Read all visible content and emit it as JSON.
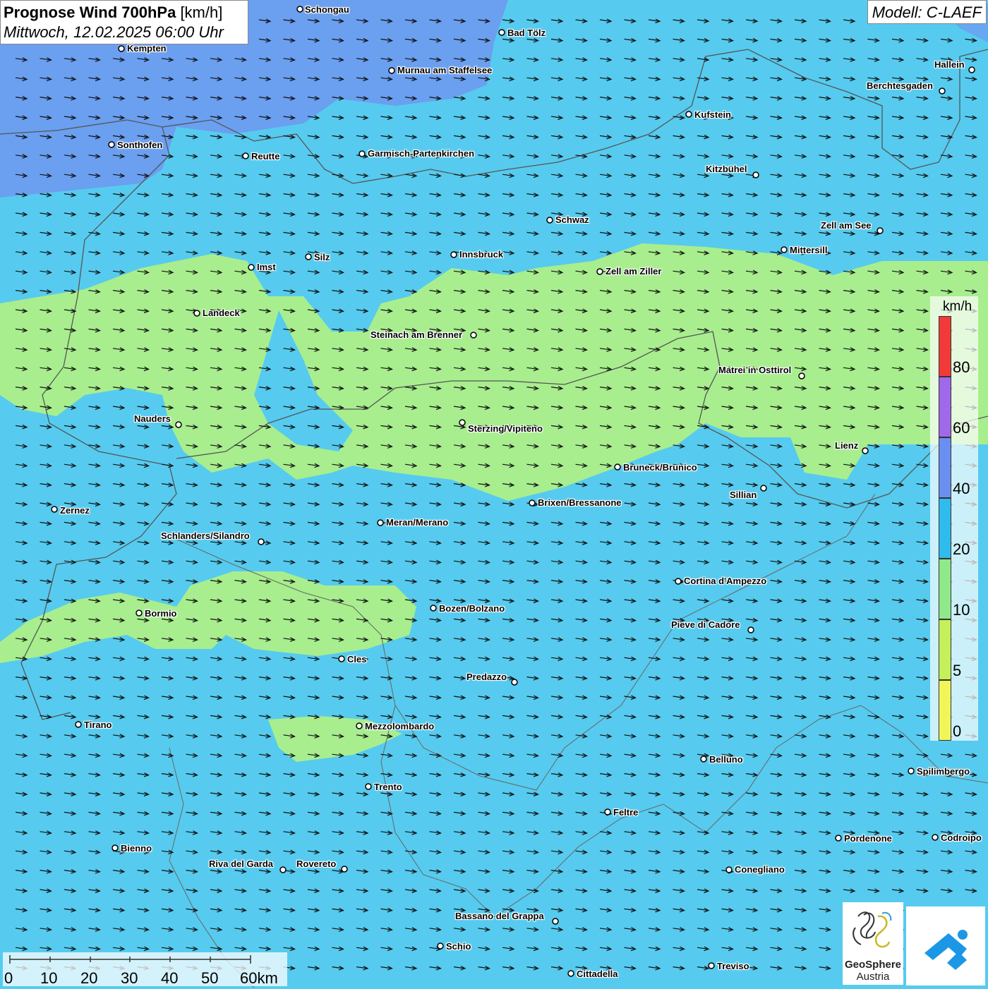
{
  "header": {
    "title_bold": "Prognose Wind 700hPa",
    "title_unit": "[km/h]",
    "date": "Mittwoch, 12.02.2025 06:00 Uhr",
    "model": "Modell: C-LAEF"
  },
  "colors": {
    "bg_wind_10_20": "#56cbef",
    "wind_5_10": "#a8ee8e",
    "wind_20_40": "#6b9ff0",
    "wind_40_60": "#7b6fd8",
    "border_line": "#555555",
    "arrow": "#111111"
  },
  "legend": {
    "unit": "km/h",
    "ticks": [
      "80",
      "60",
      "40",
      "20",
      "10",
      "5",
      "0"
    ],
    "colors": [
      "#f23a3a",
      "#a268ea",
      "#6b8ff0",
      "#2fbcec",
      "#8fe88a",
      "#c4f05a",
      "#f2f55a"
    ]
  },
  "scalebar": {
    "labels": [
      "0",
      "10",
      "20",
      "30",
      "40",
      "50",
      "60km"
    ]
  },
  "cities": [
    {
      "name": "Schongau"
    },
    {
      "name": "Bad Tölz"
    },
    {
      "name": "Kempten"
    },
    {
      "name": "Murnau am Staffelsee"
    },
    {
      "name": "Hallein"
    },
    {
      "name": "Berchtesgaden"
    },
    {
      "name": "Kufstein"
    },
    {
      "name": "Sonthofen"
    },
    {
      "name": "Reutte"
    },
    {
      "name": "Garmisch-Partenkirchen"
    },
    {
      "name": "Kitzbühel"
    },
    {
      "name": "Schwaz"
    },
    {
      "name": "Zell am See"
    },
    {
      "name": "Mittersill"
    },
    {
      "name": "Imst"
    },
    {
      "name": "Silz"
    },
    {
      "name": "Innsbruck"
    },
    {
      "name": "Zell am Ziller"
    },
    {
      "name": "Landeck"
    },
    {
      "name": "Steinach am Brenner"
    },
    {
      "name": "Matrei in Osttirol"
    },
    {
      "name": "Nauders"
    },
    {
      "name": "Sterzing/Vipiteno"
    },
    {
      "name": "Lienz"
    },
    {
      "name": "Bruneck/Brunico"
    },
    {
      "name": "Sillian"
    },
    {
      "name": "Brixen/Bressanone"
    },
    {
      "name": "Zernez"
    },
    {
      "name": "Meran/Merano"
    },
    {
      "name": "Schlanders/Silandro"
    },
    {
      "name": "Cortina d'Ampezzo"
    },
    {
      "name": "Bozen/Bolzano"
    },
    {
      "name": "Bormio"
    },
    {
      "name": "Pieve di Cadore"
    },
    {
      "name": "Cles"
    },
    {
      "name": "Predazzo"
    },
    {
      "name": "Tirano"
    },
    {
      "name": "Mezzolombardo"
    },
    {
      "name": "Belluno"
    },
    {
      "name": "Spilimbergo"
    },
    {
      "name": "Trento"
    },
    {
      "name": "Feltre"
    },
    {
      "name": "Pordenone"
    },
    {
      "name": "Codroipo"
    },
    {
      "name": "Bienno"
    },
    {
      "name": "Riva del Garda"
    },
    {
      "name": "Rovereto"
    },
    {
      "name": "Conegliano"
    },
    {
      "name": "Bassano del Grappa"
    },
    {
      "name": "Schio"
    },
    {
      "name": "Treviso"
    },
    {
      "name": "Cittadella"
    }
  ],
  "logos": {
    "geosphere_line1": "GeoSphere",
    "geosphere_line2": "Austria"
  }
}
